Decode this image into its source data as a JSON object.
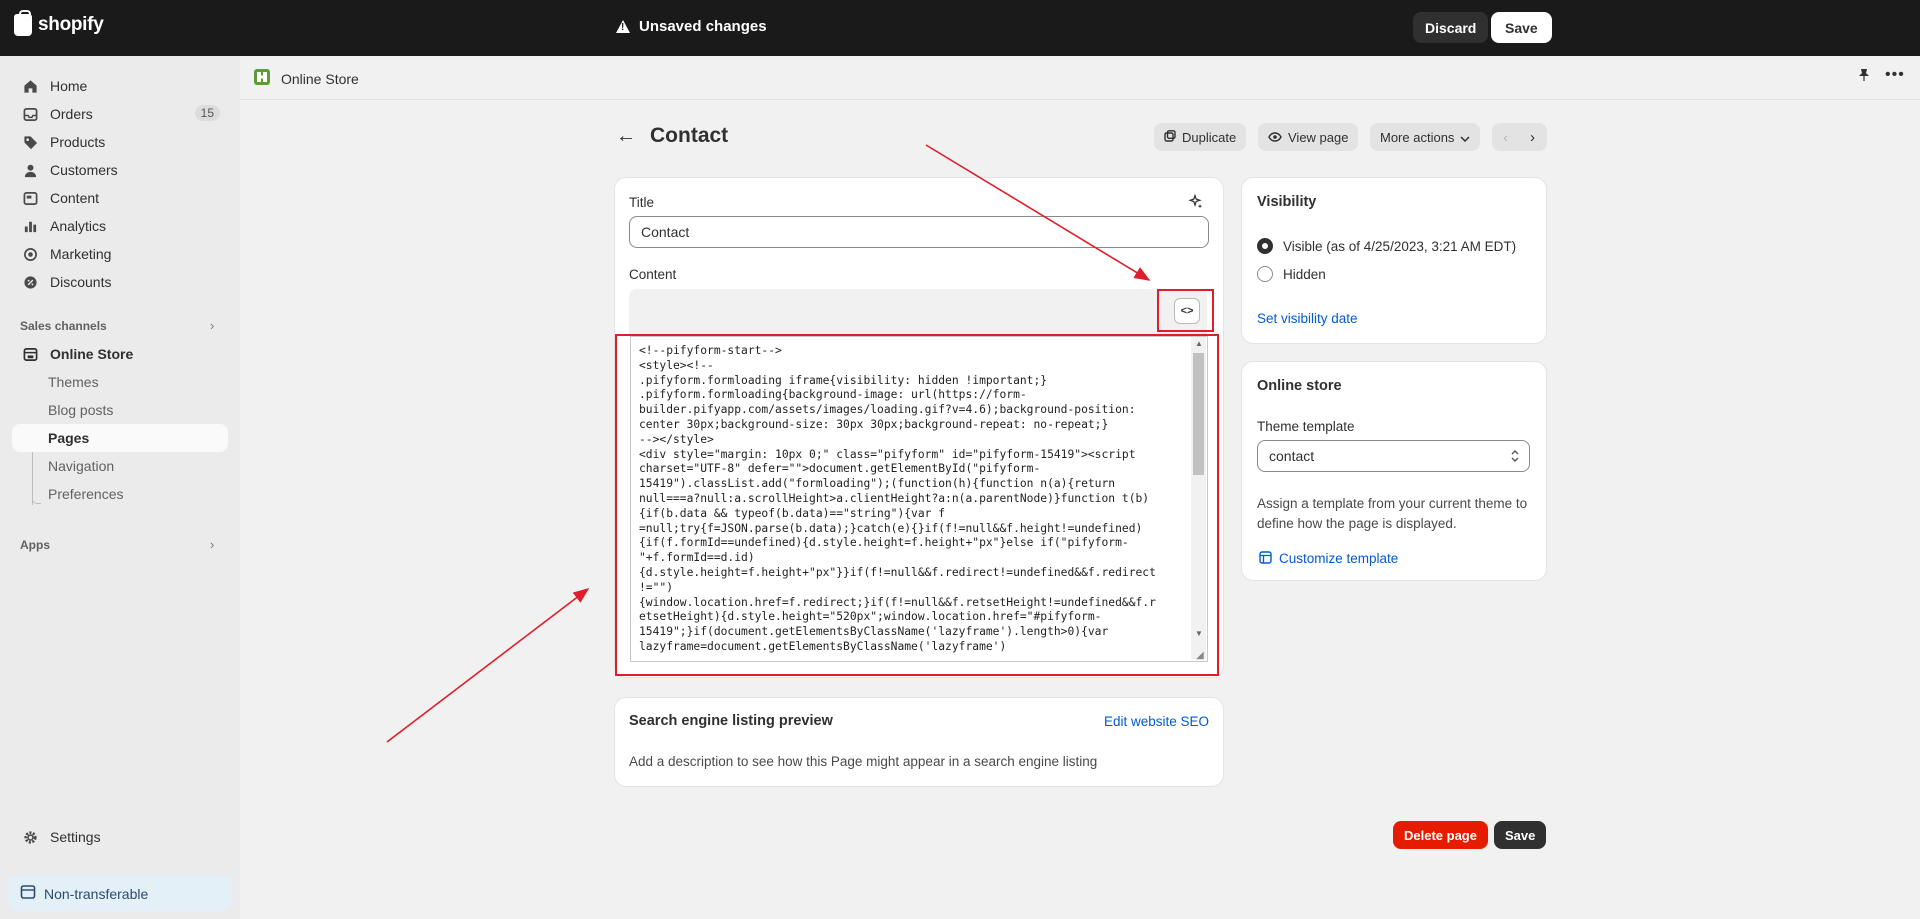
{
  "topbar": {
    "logo": "shopify",
    "status": "Unsaved changes",
    "discard": "Discard",
    "save": "Save"
  },
  "sidebar": {
    "items": [
      {
        "label": "Home",
        "icon": "home-icon"
      },
      {
        "label": "Orders",
        "icon": "inbox-icon",
        "badge": "15"
      },
      {
        "label": "Products",
        "icon": "tag-icon"
      },
      {
        "label": "Customers",
        "icon": "person-icon"
      },
      {
        "label": "Content",
        "icon": "image-icon"
      },
      {
        "label": "Analytics",
        "icon": "bar-chart-icon"
      },
      {
        "label": "Marketing",
        "icon": "target-icon"
      },
      {
        "label": "Discounts",
        "icon": "discount-icon"
      }
    ],
    "sales_channels": "Sales channels",
    "online_store": "Online Store",
    "sub_items": [
      "Themes",
      "Blog posts",
      "Pages",
      "Navigation",
      "Preferences"
    ],
    "apps": "Apps",
    "settings": "Settings",
    "non_transferable": "Non-transferable"
  },
  "header": {
    "store_title": "Online Store"
  },
  "page": {
    "title": "Contact",
    "actions": {
      "duplicate": "Duplicate",
      "view_page": "View page",
      "more_actions": "More actions"
    }
  },
  "editor": {
    "title_label": "Title",
    "title_value": "Contact",
    "content_label": "Content",
    "code_toggle": "<>",
    "code": "<!--pifyform-start-->\n<style><!--\n.pifyform.formloading iframe{visibility: hidden !important;}\n.pifyform.formloading{background-image: url(https://form-\nbuilder.pifyapp.com/assets/images/loading.gif?v=4.6);background-position:\ncenter 30px;background-size: 30px 30px;background-repeat: no-repeat;}\n--></style>\n<div style=\"margin: 10px 0;\" class=\"pifyform\" id=\"pifyform-15419\"><script\ncharset=\"UTF-8\" defer=\"\">document.getElementById(\"pifyform-\n15419\").classList.add(\"formloading\");(function(h){function n(a){return\nnull===a?null:a.scrollHeight>a.clientHeight?a:n(a.parentNode)}function t(b)\n{if(b.data && typeof(b.data)==\"string\"){var f\n=null;try{f=JSON.parse(b.data);}catch(e){}if(f!=null&&f.height!=undefined)\n{if(f.formId==undefined){d.style.height=f.height+\"px\"}else if(\"pifyform-\n\"+f.formId==d.id)\n{d.style.height=f.height+\"px\"}}if(f!=null&&f.redirect!=undefined&&f.redirect\n!=\"\")\n{window.location.href=f.redirect;}if(f!=null&&f.retsetHeight!=undefined&&f.r\netsetHeight){d.style.height=\"520px\";window.location.href=\"#pifyform-\n15419\";}if(document.getElementsByClassName('lazyframe').length>0){var\nlazyframe=document.getElementsByClassName('lazyframe')"
  },
  "seo": {
    "heading": "Search engine listing preview",
    "edit_link": "Edit website SEO",
    "description": "Add a description to see how this Page might appear in a search engine listing"
  },
  "visibility": {
    "heading": "Visibility",
    "visible": "Visible (as of 4/25/2023, 3:21 AM EDT)",
    "hidden": "Hidden",
    "set_date": "Set visibility date",
    "selected": "visible"
  },
  "online_store_card": {
    "heading": "Online store",
    "theme_label": "Theme template",
    "theme_value": "contact",
    "help": "Assign a template from your current theme to define how the page is displayed.",
    "customize": "Customize template"
  },
  "footer": {
    "delete": "Delete page",
    "save": "Save"
  },
  "colors": {
    "accent_link": "#005bd3",
    "danger": "#e51c00",
    "annotation": "#e01e2b"
  }
}
